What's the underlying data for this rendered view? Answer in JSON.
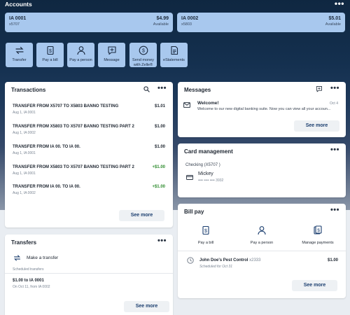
{
  "accounts": {
    "title": "Accounts",
    "more": "•••",
    "items": [
      {
        "name": "IA 0001",
        "mask": "x5707",
        "balance": "$4.99",
        "status": "Available"
      },
      {
        "name": "IA 0002",
        "mask": "x5803",
        "balance": "$5.01",
        "status": "Available"
      }
    ]
  },
  "quick_actions": [
    {
      "label": "Transfer",
      "icon": "transfer-icon"
    },
    {
      "label": "Pay a bill",
      "icon": "bill-icon"
    },
    {
      "label": "Pay a person",
      "icon": "person-icon"
    },
    {
      "label": "Message",
      "icon": "message-icon"
    },
    {
      "label": "Send money with Zelle®",
      "icon": "zelle-icon"
    },
    {
      "label": "eStatements",
      "icon": "statement-icon"
    }
  ],
  "transactions": {
    "title": "Transactions",
    "more": "•••",
    "items": [
      {
        "name": "TRANSFER FROM X5707 TO X5803 BANNO TESTING",
        "sub": "Aug 1, IA 0001",
        "amount": "$1.01",
        "positive": false
      },
      {
        "name": "TRANSFER FROM X5803 TO X5707 BANNO TESTING PART 2",
        "sub": "Aug 1, IA 0002",
        "amount": "$1.00",
        "positive": false
      },
      {
        "name": "TRANSFER FROM IA 00. TO IA 00.",
        "sub": "Aug 1, IA 0001",
        "amount": "$1.00",
        "positive": false
      },
      {
        "name": "TRANSFER FROM X5803 TO X5707 BANNO TESTING PART 2",
        "sub": "Aug 1, IA 0001",
        "amount": "+$1.00",
        "positive": true
      },
      {
        "name": "TRANSFER FROM IA 00. TO IA 00.",
        "sub": "Aug 1, IA 0002",
        "amount": "+$1.00",
        "positive": true
      }
    ],
    "see_more": "See more"
  },
  "transfers": {
    "title": "Transfers",
    "more": "•••",
    "make_transfer": "Make a transfer",
    "scheduled_label": "Scheduled transfers",
    "item_title": "$1.00 to IA 0001",
    "item_sub": "On Oct 11, from IA 0002",
    "see_more": "See more"
  },
  "messages": {
    "title": "Messages",
    "more": "•••",
    "item_title": "Welcome!",
    "item_date": "Oct 4",
    "item_body": "Welcome to our new digital banking suite. Now you can view all your accoun...",
    "see_more": "See more"
  },
  "card_management": {
    "title": "Card management",
    "more": "•••",
    "account": "Checking (X5707 )",
    "cardholder": "Mickey",
    "card_mask": "•••• •••• •••• 3932"
  },
  "bill_pay": {
    "title": "Bill pay",
    "more": "•••",
    "actions": [
      "Pay a bill",
      "Pay a person",
      "Manage payments"
    ],
    "payee": "John Doe's Pest Control",
    "payee_mask": "x2333",
    "scheduled": "Scheduled for Oct 31",
    "amount": "$1.00",
    "see_more": "See more"
  },
  "colors": {
    "accent": "#1a3d6e",
    "tile": "#a8c8ee",
    "positive": "#2f8c2f"
  }
}
